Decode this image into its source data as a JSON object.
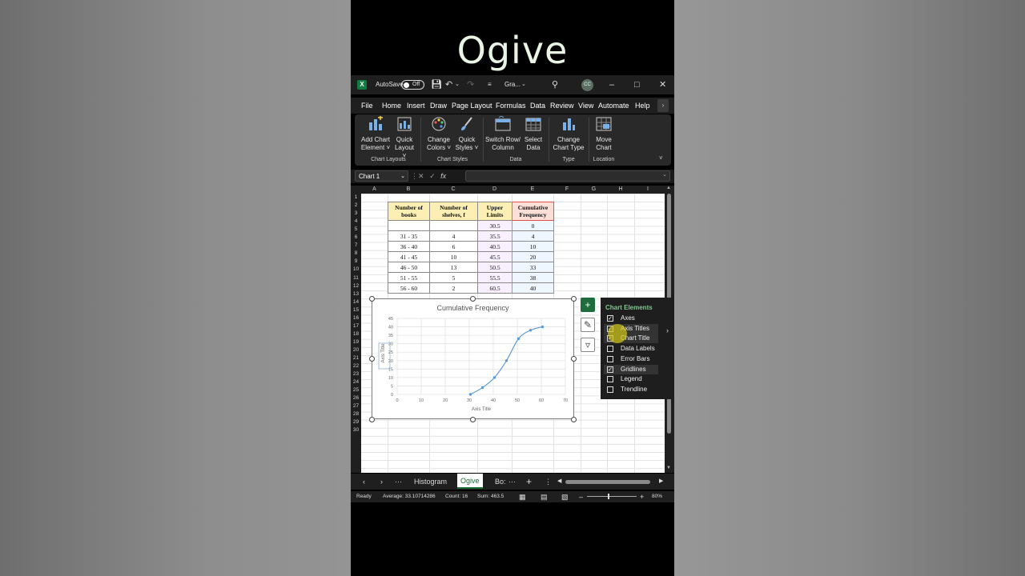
{
  "video_title": "Ogive",
  "window": {
    "autosave_label": "AutoSave",
    "autosave_state": "Off",
    "file_name": "Gra...",
    "user_initials": "CC"
  },
  "menu": [
    "File",
    "Home",
    "Insert",
    "Draw",
    "Page Layout",
    "Formulas",
    "Data",
    "Review",
    "View",
    "Automate",
    "Help"
  ],
  "ribbon": {
    "add_chart_element": [
      "Add Chart",
      "Element"
    ],
    "quick_layout": [
      "Quick",
      "Layout"
    ],
    "change_colors": [
      "Change",
      "Colors"
    ],
    "quick_styles": [
      "Quick",
      "Styles"
    ],
    "switch_row_col": [
      "Switch Row/",
      "Column"
    ],
    "select_data": [
      "Select",
      "Data"
    ],
    "change_chart_type": [
      "Change",
      "Chart Type"
    ],
    "move_chart": [
      "Move",
      "Chart"
    ],
    "groups": [
      "Chart Layouts",
      "Chart Styles",
      "Data",
      "Type",
      "Location"
    ]
  },
  "formula_bar": {
    "name_box": "Chart 1",
    "fx": "fx"
  },
  "columns": [
    "A",
    "B",
    "C",
    "D",
    "E",
    "F",
    "G",
    "H",
    "I"
  ],
  "rows": [
    "1",
    "2",
    "3",
    "4",
    "5",
    "6",
    "7",
    "8",
    "9",
    "10",
    "11",
    "12",
    "13",
    "14",
    "15",
    "16",
    "17",
    "18",
    "19",
    "20",
    "21",
    "22",
    "23",
    "24",
    "25",
    "26",
    "27",
    "28",
    "29",
    "30"
  ],
  "table": {
    "headers": [
      [
        "Number of",
        "books"
      ],
      [
        "Number of",
        "shelves, f"
      ],
      [
        "Upper",
        "Limits"
      ],
      [
        "Cumulative",
        "Frequency"
      ]
    ],
    "rows": [
      [
        "",
        "",
        "30.5",
        "0"
      ],
      [
        "31 - 35",
        "4",
        "35.5",
        "4"
      ],
      [
        "36 - 40",
        "6",
        "40.5",
        "10"
      ],
      [
        "41 - 45",
        "10",
        "45.5",
        "20"
      ],
      [
        "46 - 50",
        "13",
        "50.5",
        "33"
      ],
      [
        "51 - 55",
        "5",
        "55.5",
        "38"
      ],
      [
        "56 - 60",
        "2",
        "60.5",
        "40"
      ]
    ]
  },
  "chart_data": {
    "type": "scatter",
    "title": "Cumulative Frequency",
    "xlabel": "Axis Title",
    "ylabel": "Axis Title",
    "x": [
      30.5,
      35.5,
      40.5,
      45.5,
      50.5,
      55.5,
      60.5
    ],
    "y": [
      0,
      4,
      10,
      20,
      33,
      38,
      40
    ],
    "xlim": [
      0,
      70
    ],
    "ylim": [
      0,
      45
    ],
    "xticks": [
      0,
      10,
      20,
      30,
      40,
      50,
      60,
      70
    ],
    "yticks": [
      0,
      5,
      10,
      15,
      20,
      25,
      30,
      35,
      40,
      45
    ],
    "grid": true,
    "line_color": "#5b9bd5"
  },
  "chart_elements": {
    "header": "Chart Elements",
    "options": [
      {
        "label": "Axes",
        "checked": true
      },
      {
        "label": "Axis Titles",
        "checked": true
      },
      {
        "label": "Chart Title",
        "checked": true
      },
      {
        "label": "Data Labels",
        "checked": false
      },
      {
        "label": "Error Bars",
        "checked": false
      },
      {
        "label": "Gridlines",
        "checked": true
      },
      {
        "label": "Legend",
        "checked": false
      },
      {
        "label": "Trendline",
        "checked": false
      }
    ]
  },
  "sheet_tabs": {
    "items": [
      "Histogram",
      "Ogive",
      "Bo:"
    ],
    "active": "Ogive"
  },
  "status": {
    "ready": "Ready",
    "average": "Average: 33.10714286",
    "count": "Count: 16",
    "sum": "Sum: 463.5",
    "zoom": "80%"
  },
  "colors": {
    "excel_green": "#107c41",
    "accent_green": "#7ec88f"
  }
}
